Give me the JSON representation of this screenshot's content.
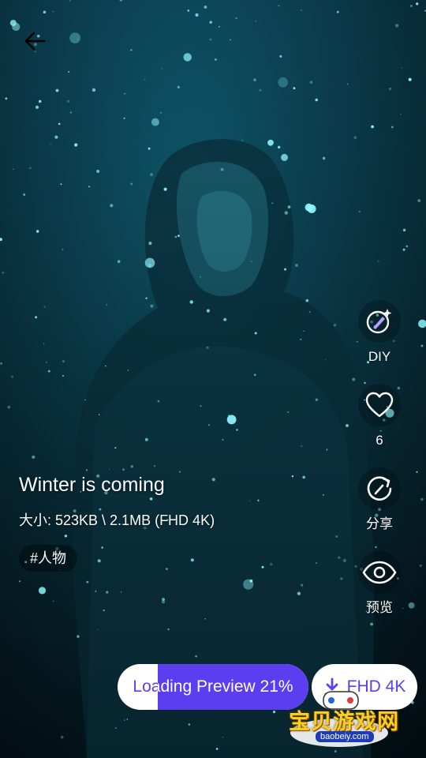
{
  "wallpaper": {
    "title": "Winter is coming",
    "size_text": "大小: 523KB \\ 2.1MB (FHD 4K)",
    "tag": "#人物"
  },
  "nav": {
    "back_icon": "arrow-left-icon"
  },
  "actions": {
    "diy": {
      "label": "DIY",
      "icon": "brush-sparkle-icon"
    },
    "like": {
      "count": "6",
      "icon": "heart-icon"
    },
    "share": {
      "label": "分享",
      "icon": "share-rotate-icon"
    },
    "preview": {
      "label": "预览",
      "icon": "eye-icon"
    }
  },
  "bottom": {
    "loading_label": "Loading Preview 21%",
    "loading_progress": 0.79,
    "download_label": "FHD 4K",
    "download_icon": "download-icon",
    "accent": "#5b3ef0"
  },
  "watermark": {
    "text": "宝贝游戏网",
    "url": "baobeiy.com"
  }
}
